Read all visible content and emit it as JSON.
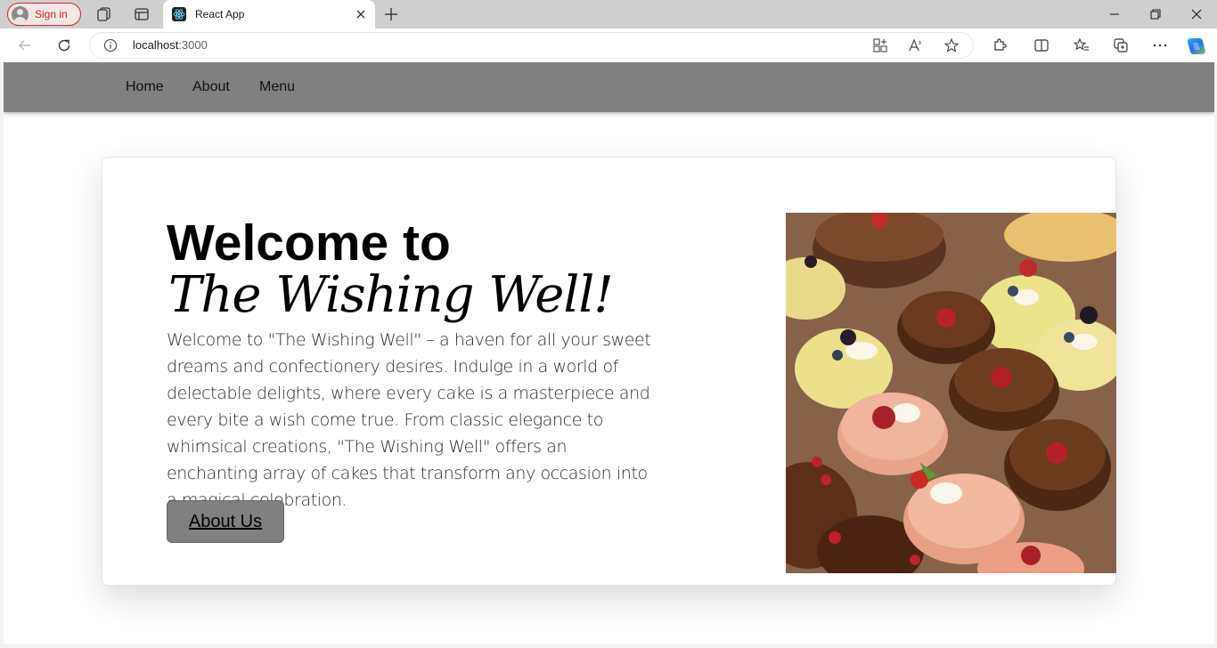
{
  "browser": {
    "signin_label": "Sign in",
    "tab_title": "React App",
    "url_host": "localhost",
    "url_port": ":3000"
  },
  "site": {
    "nav": [
      "Home",
      "About",
      "Menu"
    ],
    "heading_line1": "Welcome to",
    "heading_line2": "The Wishing Well!",
    "description": "Welcome to \"The Wishing Well\" – a haven for all your sweet dreams and confectionery desires. Indulge in a world of delectable delights, where every cake is a masterpiece and every bite a wish come true. From classic elegance to whimsical creations, \"The Wishing Well\" offers an enchanting array of cakes that transform any occasion into a magical celebration.",
    "button_label": "About Us"
  },
  "colors": {
    "nav_bg": "#808080",
    "button_bg": "#808080",
    "signin_accent": "#c42b1c"
  }
}
